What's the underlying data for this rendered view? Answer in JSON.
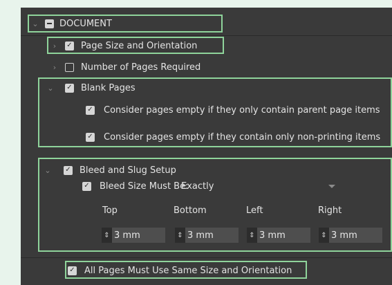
{
  "document": {
    "label": "DOCUMENT"
  },
  "page_size": {
    "label": "Page Size and Orientation"
  },
  "num_pages": {
    "label": "Number of Pages Required"
  },
  "blank_pages": {
    "label": "Blank Pages",
    "option_parent": "Consider pages empty if they only contain parent page items",
    "option_nonprinting": "Consider pages empty if they contain only non-printing items"
  },
  "bleed": {
    "label": "Bleed and Slug Setup",
    "size_label": "Bleed Size Must Be:",
    "size_value": "Exactly",
    "fields": [
      {
        "label": "Top",
        "value": "3 mm"
      },
      {
        "label": "Bottom",
        "value": "3 mm"
      },
      {
        "label": "Left",
        "value": "3 mm"
      },
      {
        "label": "Right",
        "value": "3 mm"
      }
    ]
  },
  "all_pages": {
    "label": "All Pages Must Use Same Size and Orientation"
  },
  "icons": {
    "chevron_down": "⌄",
    "chevron_right": "›",
    "check": "✓",
    "spinner": "⇕"
  }
}
